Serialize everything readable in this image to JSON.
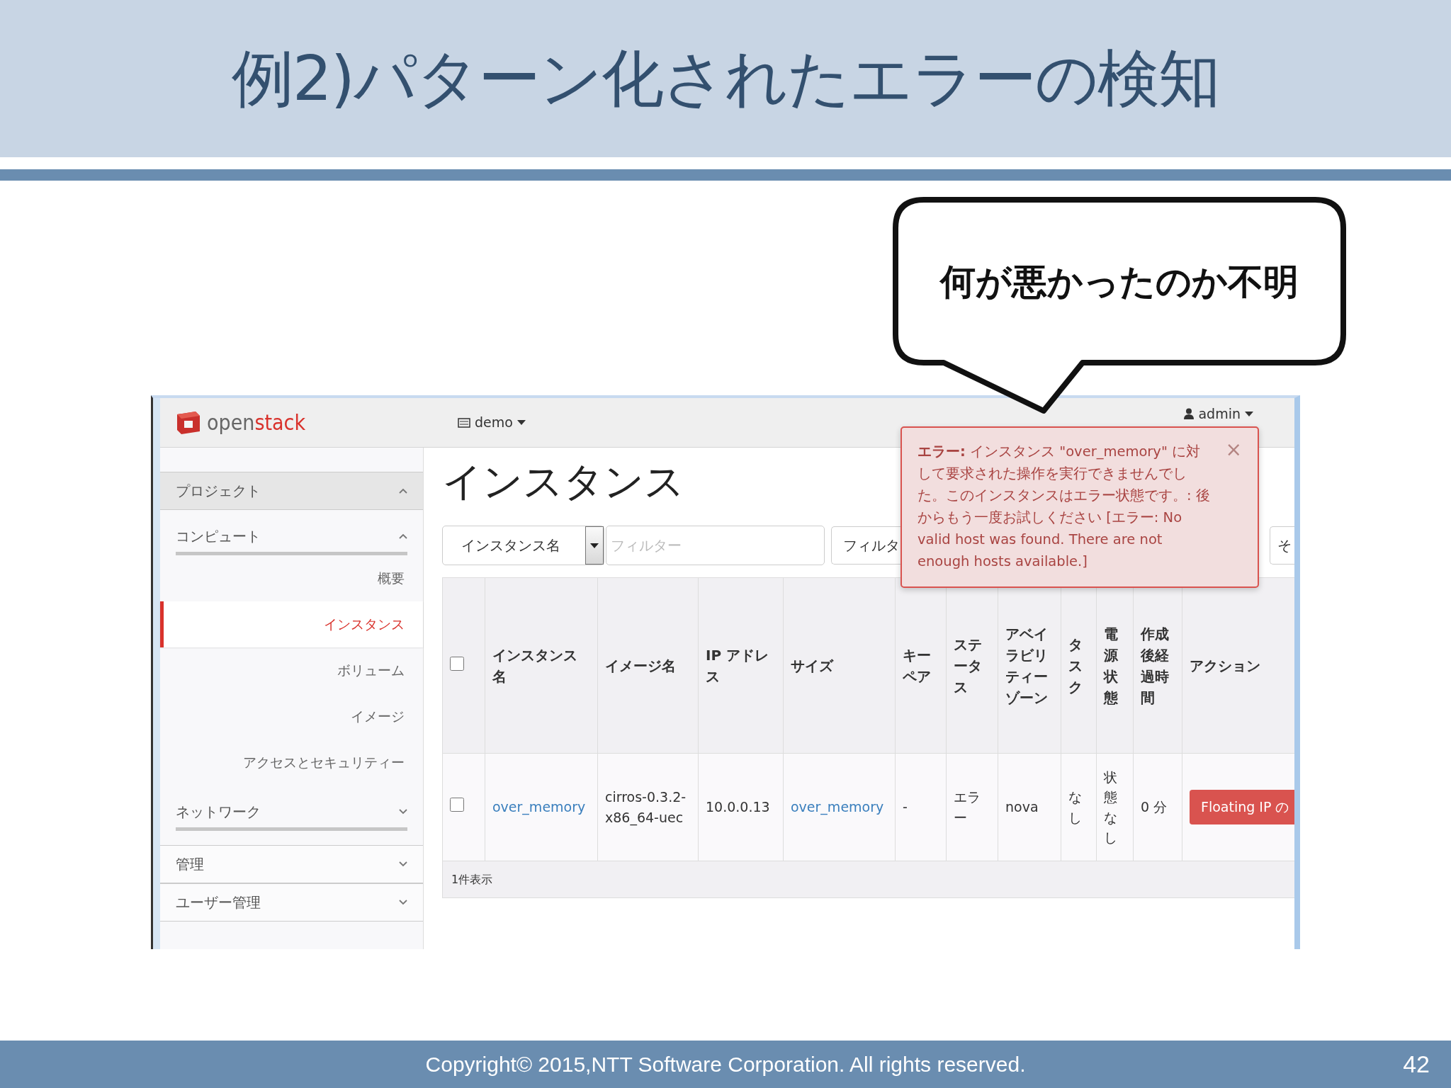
{
  "slide": {
    "title": "例2)パターン化されたエラーの検知",
    "callout": "何が悪かったのか不明",
    "footer": "Copyright© 2015,NTT Software Corporation. All rights reserved.",
    "page_number": "42"
  },
  "screen": {
    "logo": [
      "open",
      "stack"
    ],
    "project_menu": "demo",
    "user_menu": "admin",
    "sidebar": [
      {
        "label": "プロジェクト",
        "expanded": true,
        "children": [
          {
            "label": "コンピュート",
            "expanded": true,
            "children": [
              {
                "label": "概要",
                "selected": false
              },
              {
                "label": "インスタンス",
                "selected": true
              },
              {
                "label": "ボリューム",
                "selected": false
              },
              {
                "label": "イメージ",
                "selected": false
              },
              {
                "label": "アクセスとセキュリティー",
                "selected": false
              }
            ]
          },
          {
            "label": "ネットワーク",
            "expanded": false
          }
        ]
      },
      {
        "label": "管理",
        "expanded": false
      },
      {
        "label": "ユーザー管理",
        "expanded": false
      }
    ],
    "page_title": "インスタンス",
    "filter": {
      "field": "インスタンス名",
      "placeholder": "フィルター",
      "button": "フィルタ",
      "more_button": "そ"
    },
    "table": {
      "select_all_checked": false,
      "columns": [
        "インスタンス名",
        "イメージ名",
        "IP アドレス",
        "サイズ",
        "キーペア",
        "ステータス",
        "アベイラビリティーゾーン",
        "タスク",
        "電源状態",
        "作成後経過時間",
        "アクション"
      ],
      "rows": [
        {
          "checked": false,
          "cells": [
            {
              "kind": "link",
              "text": "over_memory"
            },
            {
              "kind": "text",
              "text": "cirros-0.3.2-x86_64-uec"
            },
            {
              "kind": "text",
              "text": "10.0.0.13"
            },
            {
              "kind": "link",
              "text": "over_memory"
            },
            {
              "kind": "text",
              "text": "-"
            },
            {
              "kind": "text",
              "text": "エラー"
            },
            {
              "kind": "text",
              "text": "nova"
            },
            {
              "kind": "text",
              "text": "なし"
            },
            {
              "kind": "text",
              "text": "状態なし"
            },
            {
              "kind": "text",
              "text": "0 分"
            },
            {
              "kind": "button",
              "text": "Floating IP の"
            }
          ]
        }
      ],
      "footer": "1件表示"
    },
    "alert": {
      "message": "**エラー:** インスタンス \"over_memory\" に対して要求された操作を実行できませんでした。このインスタンスはエラー状態です。: 後からもう一度お試しください [エラー: No valid host was found. There are not enough hosts available.]",
      "close": "×"
    }
  }
}
